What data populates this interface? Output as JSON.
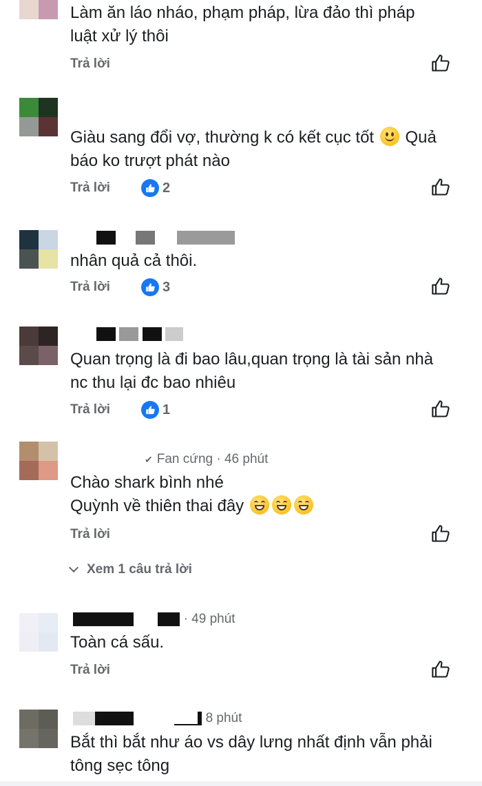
{
  "comments": [
    {
      "text_lines": [
        "Làm ăn láo nháo, phạm pháp, lừa đảo thì pháp",
        "luật xử lý thôi"
      ],
      "reply_label": "Trả lời",
      "reactions": null
    },
    {
      "text_lines": [
        "Giàu sang đổi vợ, thường k có kết cục tốt",
        "Quả",
        "báo ko trượt phát nào"
      ],
      "reply_label": "Trả lời",
      "reactions": "2"
    },
    {
      "text_lines": [
        "nhân quả cả thôi."
      ],
      "reply_label": "Trả lời",
      "reactions": "3"
    },
    {
      "text_lines": [
        "Quan trọng là đi bao lâu,quan trọng là tài sản nhà",
        "nc thu lại đc bao nhiêu"
      ],
      "reply_label": "Trả lời",
      "reactions": "1"
    },
    {
      "meta": "Fan cứng · 46 phút",
      "text_lines": [
        "Chào shark bình nhé",
        "Quỳnh về thiên thai đây"
      ],
      "reply_label": "Trả lời",
      "reactions": null,
      "view_replies": "Xem 1 câu trả lời"
    },
    {
      "meta": "· 49 phút",
      "text_lines": [
        "Toàn cá sấu."
      ],
      "reply_label": "Trả lời",
      "reactions": null
    },
    {
      "meta": "8 phút",
      "text_lines": [
        "Bắt thì bắt như áo vs dây lưng nhất định vẫn phải",
        "tông sẹc tông"
      ]
    }
  ],
  "colors": {
    "like_blue": "#1877f2",
    "muted_text": "#65676b",
    "body_text": "#1c1e21"
  },
  "icons": {
    "like": "thumbs-up-outline-icon",
    "reaction": "like-reaction-icon",
    "emoji_smile": "smiling-face-icon",
    "emoji_grin": "grinning-face-icon"
  }
}
